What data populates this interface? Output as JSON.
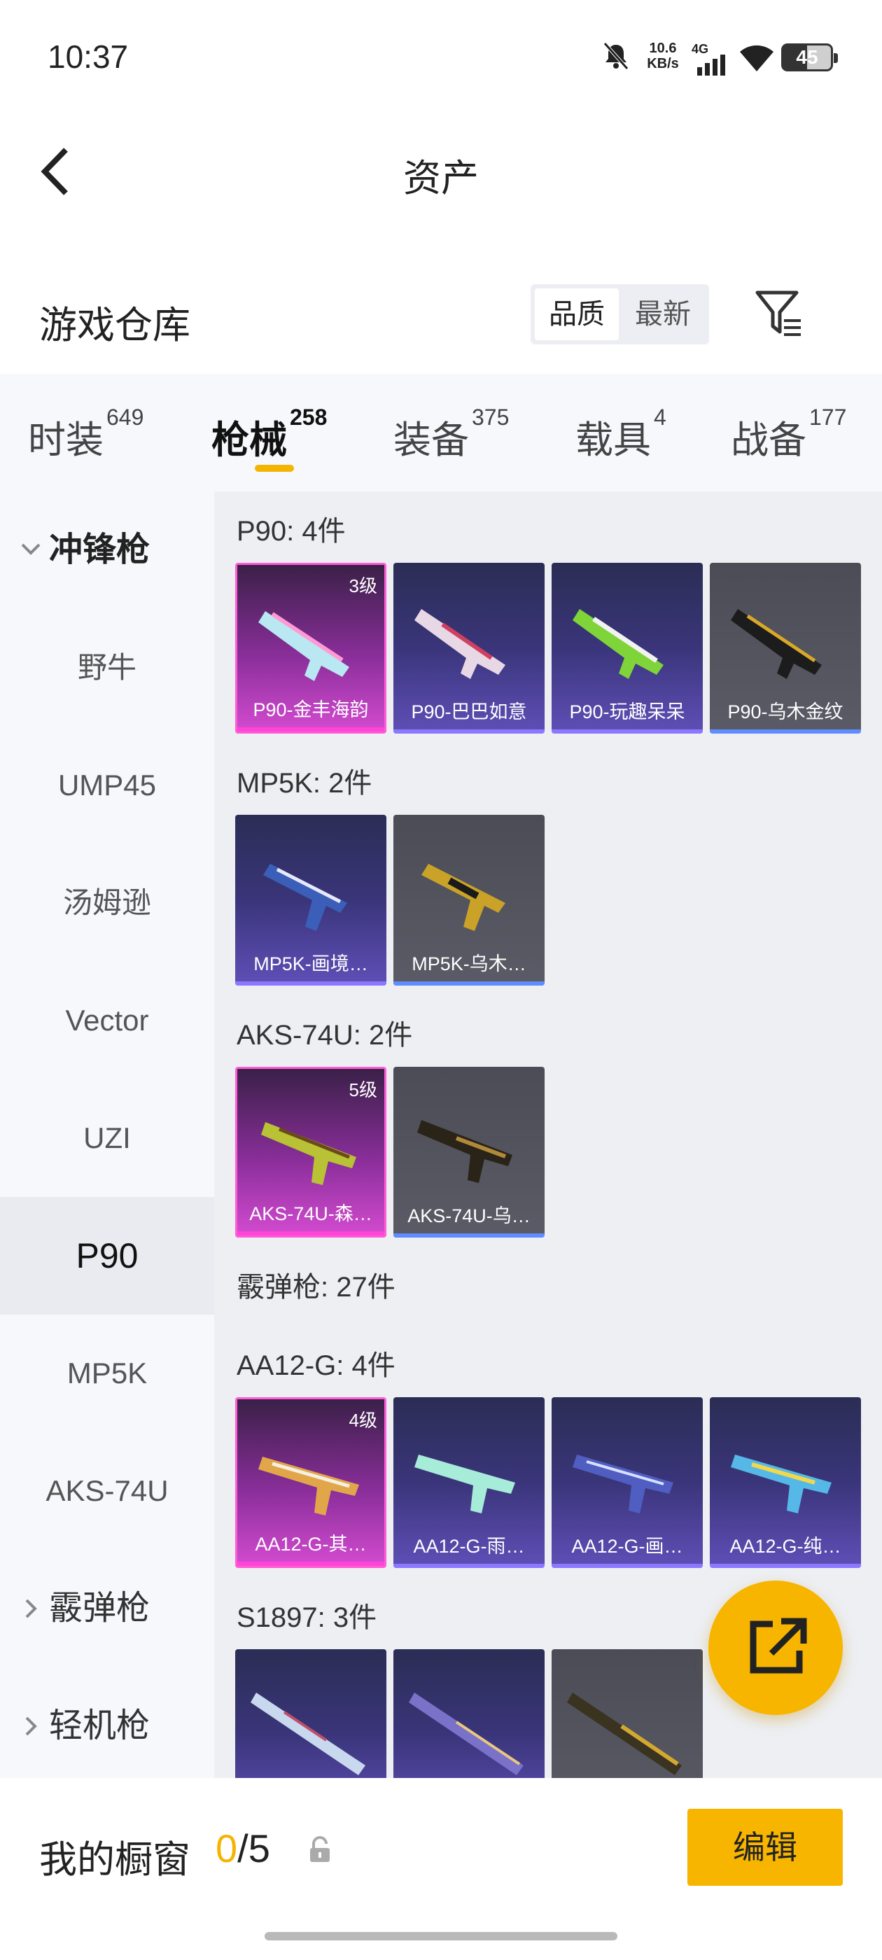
{
  "status_bar": {
    "time": "10:37",
    "speed_value": "10.6",
    "speed_unit": "KB/s",
    "network": "4G",
    "battery": "45"
  },
  "header": {
    "title": "资产"
  },
  "warehouse": {
    "title": "游戏仓库",
    "sort_quality": "品质",
    "sort_newest": "最新"
  },
  "tabs": [
    {
      "label": "时装",
      "count": "649"
    },
    {
      "label": "枪械",
      "count": "258"
    },
    {
      "label": "装备",
      "count": "375"
    },
    {
      "label": "载具",
      "count": "4"
    },
    {
      "label": "战备",
      "count": "177"
    }
  ],
  "sidebar": {
    "group_smg": "冲锋枪",
    "items": [
      "野牛",
      "UMP45",
      "汤姆逊",
      "Vector",
      "UZI",
      "P90",
      "MP5K",
      "AKS-74U"
    ],
    "group_shotgun": "霰弹枪",
    "group_lmg": "轻机枪"
  },
  "content": {
    "groups": [
      {
        "title": "P90: 4件",
        "cards": [
          {
            "name": "P90-金丰海韵",
            "level": "3级",
            "rarity": "legend"
          },
          {
            "name": "P90-巴巴如意",
            "rarity": "epic"
          },
          {
            "name": "P90-玩趣呆呆",
            "rarity": "epic"
          },
          {
            "name": "P90-乌木金纹",
            "rarity": "rare"
          }
        ]
      },
      {
        "title": "MP5K: 2件",
        "cards": [
          {
            "name": "MP5K-画境…",
            "rarity": "epic"
          },
          {
            "name": "MP5K-乌木…",
            "rarity": "rare"
          }
        ]
      },
      {
        "title": "AKS-74U: 2件",
        "cards": [
          {
            "name": "AKS-74U-森…",
            "level": "5级",
            "rarity": "legend"
          },
          {
            "name": "AKS-74U-乌…",
            "rarity": "rare"
          }
        ]
      },
      {
        "title": "霰弹枪: 27件",
        "cards": []
      },
      {
        "title": "AA12-G: 4件",
        "cards": [
          {
            "name": "AA12-G-其…",
            "level": "4级",
            "rarity": "legend"
          },
          {
            "name": "AA12-G-雨…",
            "rarity": "epic"
          },
          {
            "name": "AA12-G-画…",
            "rarity": "epic"
          },
          {
            "name": "AA12-G-纯…",
            "rarity": "epic"
          }
        ]
      },
      {
        "title": "S1897: 3件",
        "cards": [
          {
            "rarity": "epic"
          },
          {
            "rarity": "epic"
          },
          {
            "rarity": "rare"
          }
        ]
      }
    ]
  },
  "showcase": {
    "label": "我的橱窗",
    "current": "0",
    "total": "/5",
    "edit_label": "编辑"
  },
  "colors": {
    "accent": "#f5b400",
    "legend": "#ff45d8",
    "epic": "#8a79ff",
    "rare": "#5f8dff"
  }
}
